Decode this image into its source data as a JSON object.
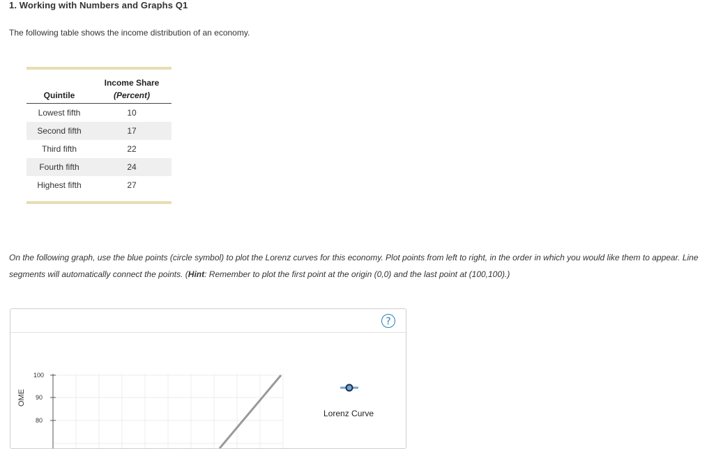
{
  "question": {
    "title": "1. Working with Numbers and Graphs Q1",
    "intro": "The following table shows the income distribution of an economy."
  },
  "table": {
    "header_quintile": "Quintile",
    "header_share_line1": "Income Share",
    "header_share_line2": "(Percent)",
    "rows": [
      {
        "quintile": "Lowest fifth",
        "share": "10"
      },
      {
        "quintile": "Second fifth",
        "share": "17"
      },
      {
        "quintile": "Third fifth",
        "share": "22"
      },
      {
        "quintile": "Fourth fifth",
        "share": "24"
      },
      {
        "quintile": "Highest fifth",
        "share": "27"
      }
    ]
  },
  "instructions": {
    "part1": "On the following graph, use the blue points (circle symbol) to plot the Lorenz curves for this economy. Plot points from left to right, in the order in which you would like them to appear. Line segments will automatically connect the points. (",
    "hint_label": "Hint",
    "part2": ": Remember to plot the first point at the origin (0,0) and the last point at (100,100).)"
  },
  "graph": {
    "help_symbol": "?",
    "y_axis_label": "OME",
    "y_ticks": [
      "100",
      "90",
      "80"
    ],
    "legend_label": "Lorenz Curve",
    "legend_icon": "circle-point-icon",
    "accent_color": "#2a7fb8",
    "equality_line_color": "#999999"
  }
}
